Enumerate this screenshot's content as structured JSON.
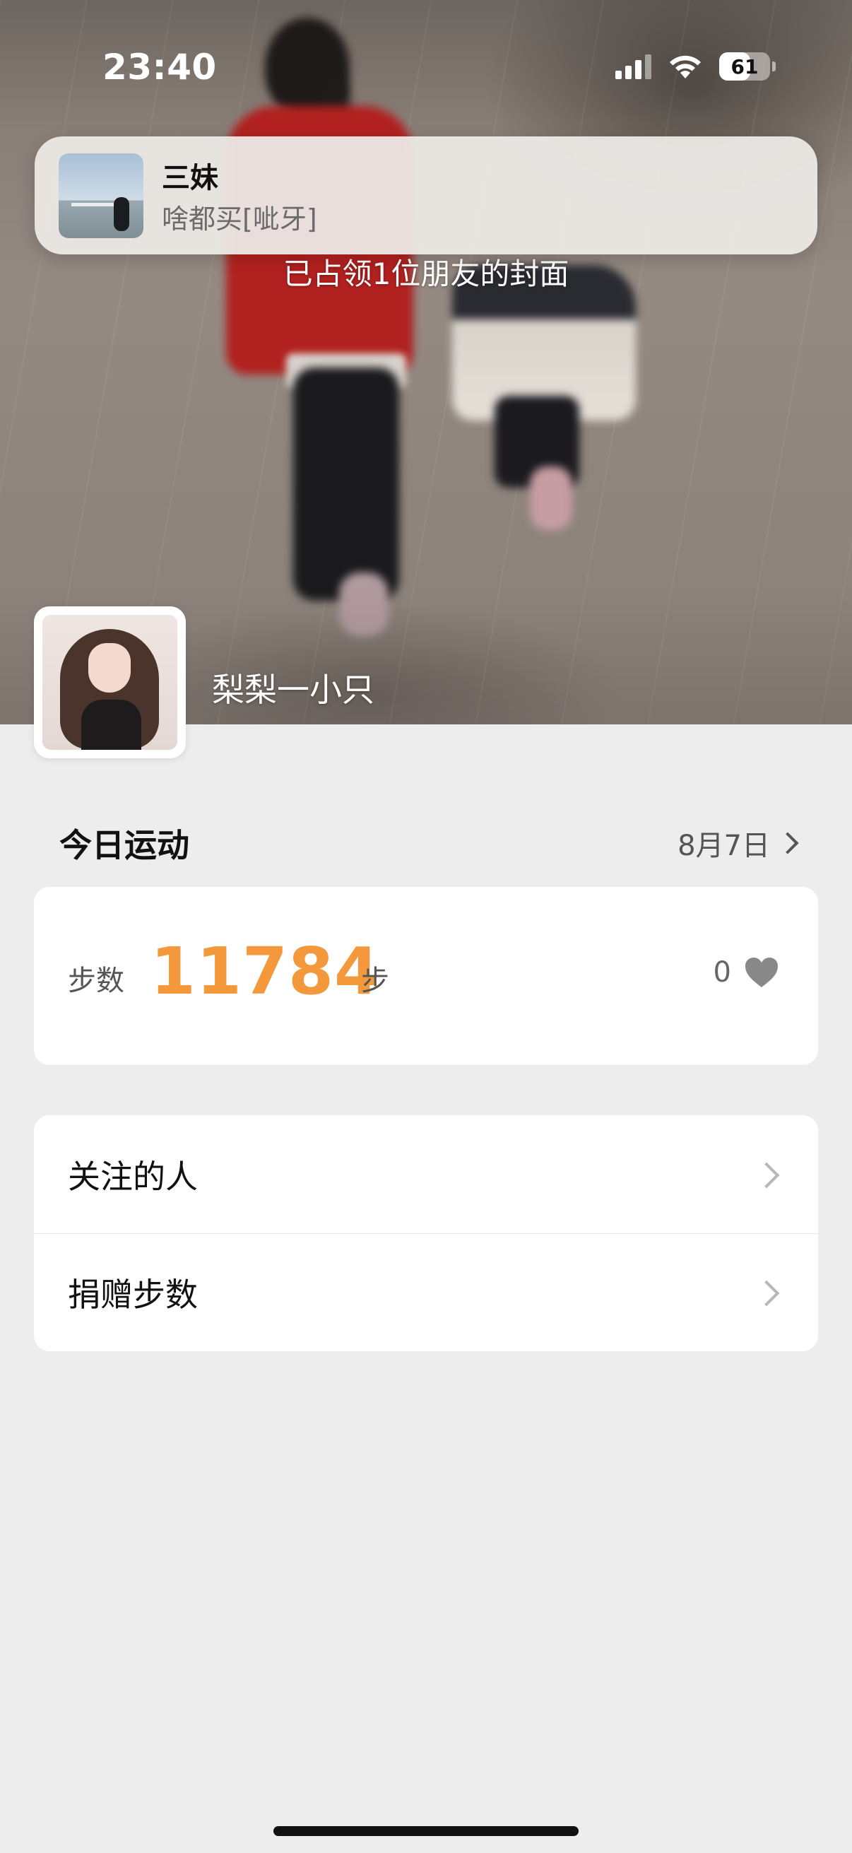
{
  "status_bar": {
    "time": "23:40",
    "battery_percent": "61",
    "battery_level": 0.61,
    "icons": [
      "signal-icon",
      "wifi-icon",
      "battery-icon"
    ]
  },
  "notification": {
    "title": "三妹",
    "message": "啥都买[呲牙]"
  },
  "cover": {
    "occupied_text": "已占领1位朋友的封面"
  },
  "profile": {
    "name": "梨梨一小只"
  },
  "today": {
    "title": "今日运动",
    "date": "8月7日"
  },
  "steps": {
    "label": "步数",
    "value": "11784",
    "unit": "步",
    "likes": "0",
    "accent_color": "#f4993b"
  },
  "menu": {
    "items": [
      {
        "label": "关注的人"
      },
      {
        "label": "捐赠步数"
      }
    ]
  }
}
